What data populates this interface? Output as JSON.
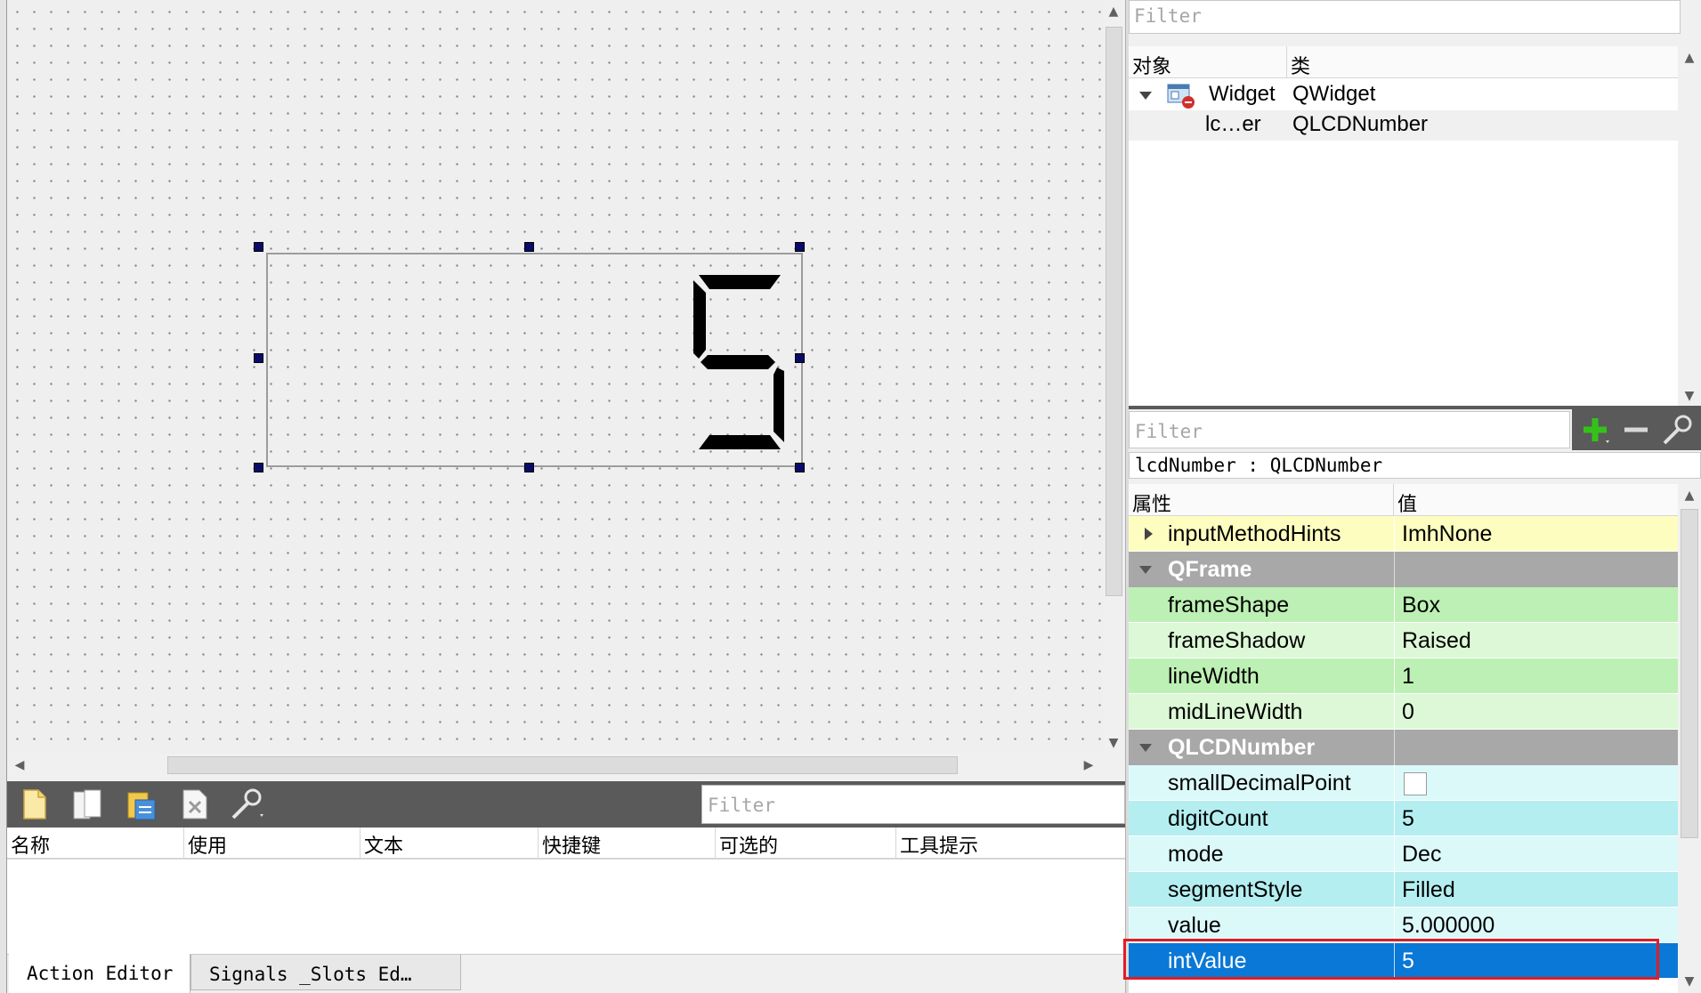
{
  "canvas": {
    "lcd_display_digit": "5"
  },
  "action_editor": {
    "filter_placeholder": "Filter",
    "columns": [
      "名称",
      "使用",
      "文本",
      "快捷键",
      "可选的",
      "工具提示"
    ],
    "toolbar_icons": [
      "new-action-icon",
      "copy-action-icon",
      "paste-action-icon",
      "delete-action-icon",
      "configure-icon"
    ]
  },
  "tabs": {
    "action_editor": "Action Editor",
    "signals_slots": "Signals _Slots Ed…"
  },
  "object_inspector": {
    "filter_placeholder": "Filter",
    "col_object": "对象",
    "col_class": "类",
    "rows": [
      {
        "name": "Widget",
        "class": "QWidget"
      },
      {
        "name": "lc…er",
        "class": "QLCDNumber"
      }
    ]
  },
  "property_editor": {
    "filter_placeholder": "Filter",
    "object_label": "lcdNumber : QLCDNumber",
    "col_property": "属性",
    "col_value": "值",
    "rows": {
      "inputMethodHints": {
        "name": "inputMethodHints",
        "value": "ImhNone"
      },
      "group_qframe": "QFrame",
      "frameShape": {
        "name": "frameShape",
        "value": "Box"
      },
      "frameShadow": {
        "name": "frameShadow",
        "value": "Raised"
      },
      "lineWidth": {
        "name": "lineWidth",
        "value": "1"
      },
      "midLineWidth": {
        "name": "midLineWidth",
        "value": "0"
      },
      "group_qlcd": "QLCDNumber",
      "smallDecimalPoint": {
        "name": "smallDecimalPoint",
        "value": false
      },
      "digitCount": {
        "name": "digitCount",
        "value": "5"
      },
      "mode": {
        "name": "mode",
        "value": "Dec"
      },
      "segmentStyle": {
        "name": "segmentStyle",
        "value": "Filled"
      },
      "value": {
        "name": "value",
        "value": "5.000000"
      },
      "intValue": {
        "name": "intValue",
        "value": "5"
      }
    }
  },
  "colors": {
    "toolbar_bg": "#5a5a5a",
    "qframe_row_a": "#bdf0b4",
    "qframe_row_b": "#dcf8d6",
    "qlcd_row_a": "#b4eef0",
    "qlcd_row_b": "#dcf9fa",
    "qobject_row": "#fdfdc0",
    "selection": "#0a78d7",
    "highlight_box": "#e01c24"
  }
}
